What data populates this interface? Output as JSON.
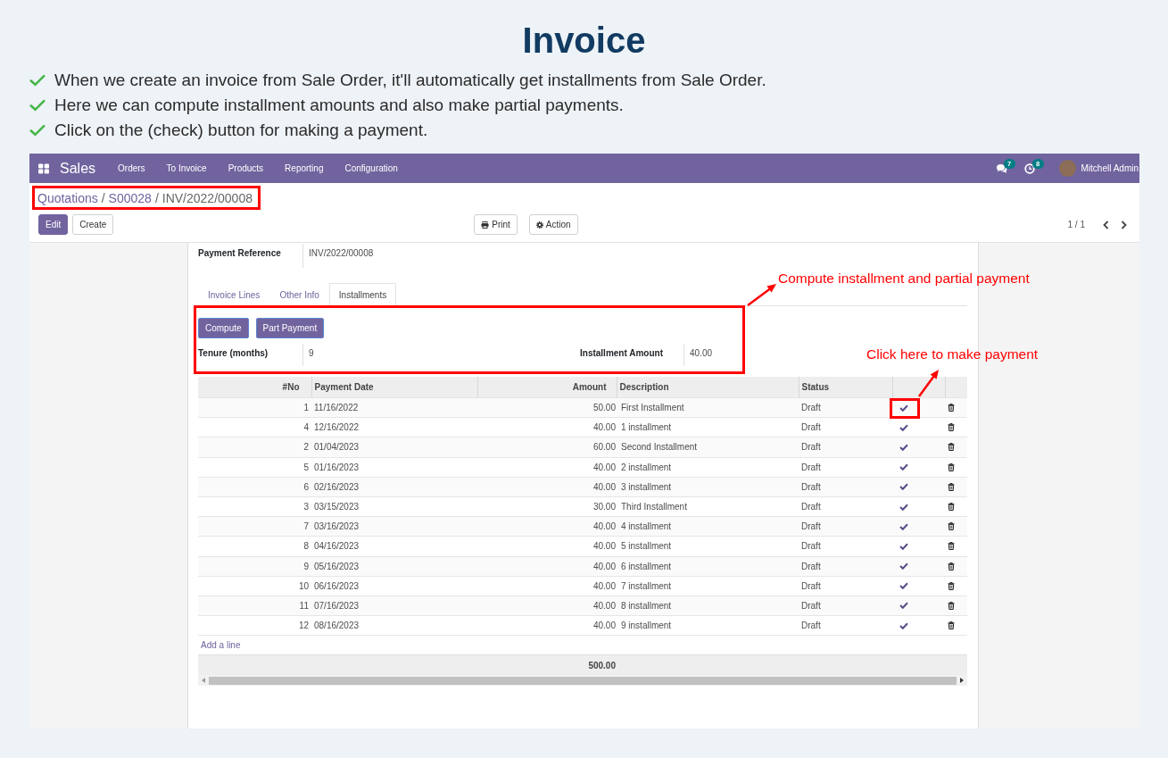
{
  "header": {
    "title": "Invoice",
    "bullets": [
      "When we create an invoice from Sale Order, it'll automatically get installments from Sale Order.",
      "Here we can compute installment amounts and also make partial payments.",
      "Click on the (check) button for making a payment."
    ]
  },
  "navbar": {
    "app_name": "Sales",
    "menu": [
      "Orders",
      "To Invoice",
      "Products",
      "Reporting",
      "Configuration"
    ],
    "messages_badge": "7",
    "activities_badge": "8",
    "user_name": "Mitchell Admin"
  },
  "breadcrumb": {
    "separator": "/",
    "items": [
      {
        "label": "Quotations",
        "current": false
      },
      {
        "label": "S00028",
        "current": false
      },
      {
        "label": "INV/2022/00008",
        "current": true
      }
    ]
  },
  "actions": {
    "left": [
      {
        "label": "Edit",
        "kind": "primary"
      },
      {
        "label": "Create",
        "kind": "secondary"
      }
    ],
    "middle": [
      {
        "label": "Print",
        "kind": "print"
      },
      {
        "label": "Action",
        "kind": "gear"
      }
    ],
    "pager": "1 / 1"
  },
  "form": {
    "fields": [
      {
        "label": "Payment Reference",
        "value": "INV/2022/00008"
      }
    ],
    "tabs": [
      {
        "label": "Invoice Lines",
        "selected": false
      },
      {
        "label": "Other Info",
        "selected": false
      },
      {
        "label": "Installments",
        "selected": true
      }
    ],
    "installments": {
      "buttons": [
        "Compute",
        "Part Payment"
      ],
      "fields": [
        {
          "label": "Tenure (months)",
          "value": "9"
        },
        {
          "label": "Installment Amount",
          "value": "40.00"
        }
      ],
      "table": {
        "columns": [
          "#No",
          "Payment Date",
          "Amount",
          "Description",
          "Status"
        ],
        "rows": [
          {
            "no": "1",
            "payment_date": "11/16/2022",
            "amount": "50.00",
            "description": "First Installment",
            "status": "Draft"
          },
          {
            "no": "4",
            "payment_date": "12/16/2022",
            "amount": "40.00",
            "description": "1 installment",
            "status": "Draft"
          },
          {
            "no": "2",
            "payment_date": "01/04/2023",
            "amount": "60.00",
            "description": "Second Installment",
            "status": "Draft"
          },
          {
            "no": "5",
            "payment_date": "01/16/2023",
            "amount": "40.00",
            "description": "2 installment",
            "status": "Draft"
          },
          {
            "no": "6",
            "payment_date": "02/16/2023",
            "amount": "40.00",
            "description": "3 installment",
            "status": "Draft"
          },
          {
            "no": "3",
            "payment_date": "03/15/2023",
            "amount": "30.00",
            "description": "Third Installment",
            "status": "Draft"
          },
          {
            "no": "7",
            "payment_date": "03/16/2023",
            "amount": "40.00",
            "description": "4 installment",
            "status": "Draft"
          },
          {
            "no": "8",
            "payment_date": "04/16/2023",
            "amount": "40.00",
            "description": "5 installment",
            "status": "Draft"
          },
          {
            "no": "9",
            "payment_date": "05/16/2023",
            "amount": "40.00",
            "description": "6 installment",
            "status": "Draft"
          },
          {
            "no": "10",
            "payment_date": "06/16/2023",
            "amount": "40.00",
            "description": "7 installment",
            "status": "Draft"
          },
          {
            "no": "11",
            "payment_date": "07/16/2023",
            "amount": "40.00",
            "description": "8 installment",
            "status": "Draft"
          },
          {
            "no": "12",
            "payment_date": "08/16/2023",
            "amount": "40.00",
            "description": "9 installment",
            "status": "Draft"
          }
        ],
        "add_line": "Add a line",
        "total": "500.00"
      }
    }
  },
  "annotations": [
    {
      "text": "Compute installment and partial payment"
    },
    {
      "text": "Click here to make payment"
    }
  ]
}
